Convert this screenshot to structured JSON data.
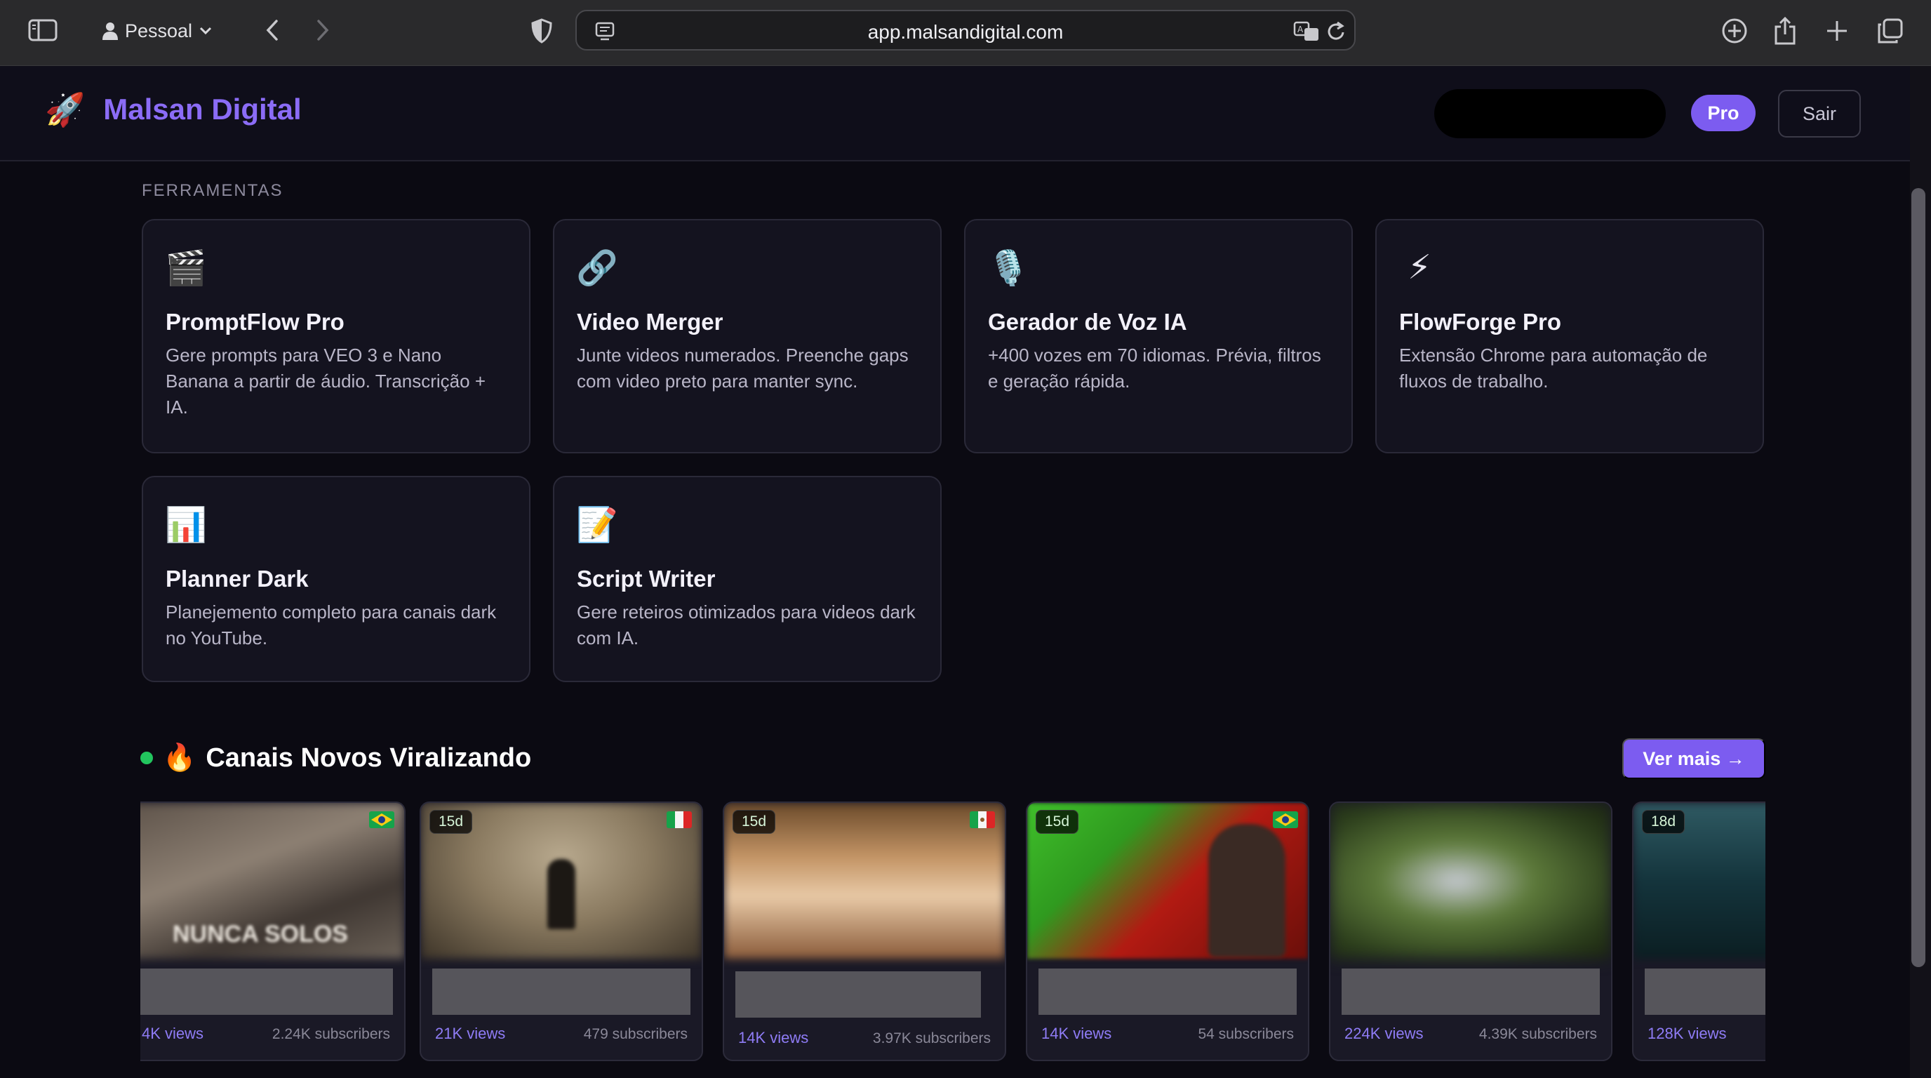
{
  "browser": {
    "profile_label": "Pessoal",
    "url": "app.malsandigital.com"
  },
  "header": {
    "brand_name": "Malsan Digital",
    "brand_logo": "🚀",
    "plan_badge": "Pro",
    "logout_label": "Sair"
  },
  "tools": {
    "section_label": "FERRAMENTAS",
    "items": [
      {
        "icon": "🎬",
        "icon_name": "clapperboard-icon",
        "title": "PromptFlow Pro",
        "description": "Gere prompts para VEO 3 e Nano Banana a partir de áudio. Transcrição + IA."
      },
      {
        "icon": "🔗",
        "icon_name": "link-icon",
        "title": "Video Merger",
        "description": "Junte videos numerados. Preenche gaps com video preto para manter sync."
      },
      {
        "icon": "🎙️",
        "icon_name": "microphone-icon",
        "title": "Gerador de Voz IA",
        "description": "+400 vozes em 70 idiomas. Prévia, filtros e geração rápida."
      },
      {
        "icon": "⚡",
        "icon_name": "lightning-icon",
        "title": "FlowForge Pro",
        "description": "Extensão Chrome para automação de fluxos de trabalho."
      },
      {
        "icon": "📊",
        "icon_name": "bar-chart-icon",
        "title": "Planner Dark",
        "description": "Planejemento completo para canais dark no YouTube."
      },
      {
        "icon": "📝",
        "icon_name": "memo-icon",
        "title": "Script Writer",
        "description": "Gere reteiros otimizados para videos dark com IA."
      }
    ]
  },
  "channels": {
    "title": "Canais Novos Viralizando",
    "title_emoji": "🔥",
    "see_more_label": "Ver mais →",
    "accent_color": "#7c5cf0",
    "items": [
      {
        "age": "",
        "country": "brazil-flag",
        "views": "4K views",
        "subscribers": "2.24K subscribers"
      },
      {
        "age": "15d",
        "country": "italy-flag",
        "views": "21K views",
        "subscribers": "479 subscribers"
      },
      {
        "age": "15d",
        "country": "mexico-flag",
        "views": "14K views",
        "subscribers": "3.97K subscribers"
      },
      {
        "age": "15d",
        "country": "brazil-flag",
        "views": "14K views",
        "subscribers": "54 subscribers"
      },
      {
        "age": "",
        "country": "",
        "views": "224K views",
        "subscribers": "4.39K subscribers"
      },
      {
        "age": "18d",
        "country": "",
        "views": "128K views",
        "subscribers": ""
      }
    ]
  }
}
